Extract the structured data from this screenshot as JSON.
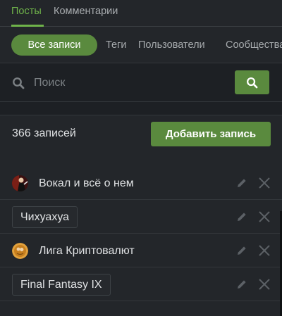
{
  "tabs": [
    {
      "label": "Посты",
      "active": true
    },
    {
      "label": "Комментарии",
      "active": false
    }
  ],
  "filters": {
    "active": "Все записи",
    "items": [
      "Теги",
      "Пользователи",
      "Сообщества"
    ]
  },
  "search": {
    "placeholder": "Поиск",
    "button_icon": "search-icon"
  },
  "records": {
    "count_label": "366 записей",
    "add_label": "Добавить запись"
  },
  "items": [
    {
      "label": "Вокал и всё о нем",
      "kind": "avatar",
      "icon": "singer-avatar-icon"
    },
    {
      "label": "Чихуахуа",
      "kind": "tag"
    },
    {
      "label": "Лига Криптовалют",
      "kind": "avatar",
      "icon": "bitcoin-avatar-icon"
    },
    {
      "label": "Final Fantasy IX",
      "kind": "tag"
    }
  ],
  "colors": {
    "accent": "#6fb34a",
    "button": "#5a8a3e",
    "background": "#23262a",
    "search_bg": "#1d2024"
  }
}
